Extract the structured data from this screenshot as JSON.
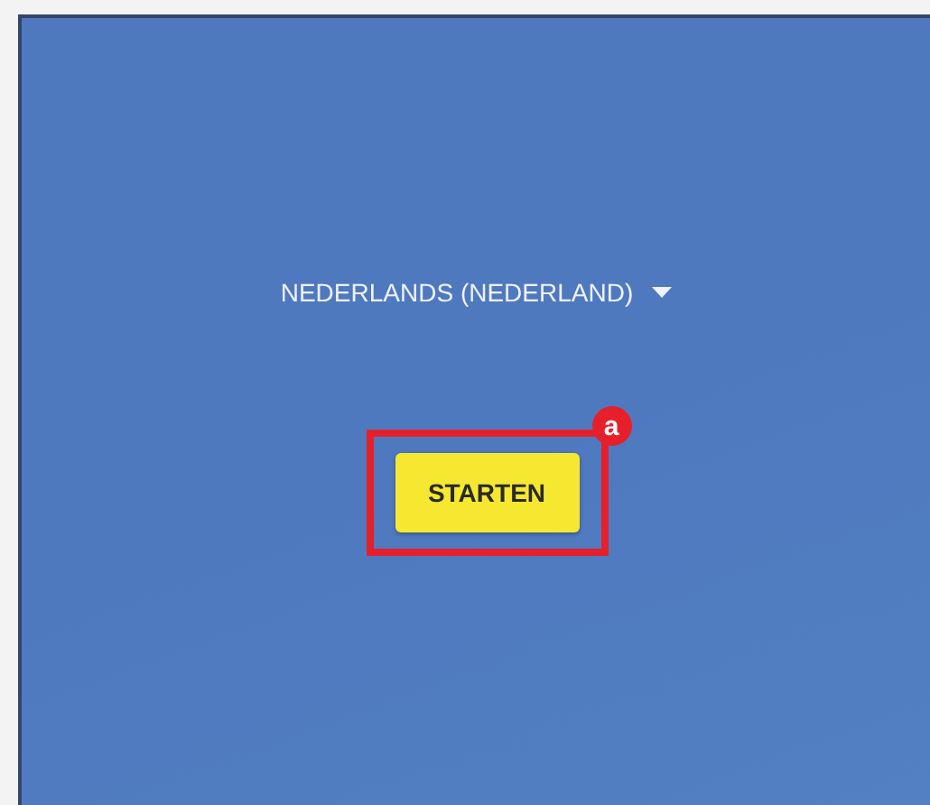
{
  "language_selector": {
    "label": "NEDERLANDS (NEDERLAND)"
  },
  "start_button": {
    "label": "STARTEN"
  },
  "annotation": {
    "marker": "a"
  }
}
